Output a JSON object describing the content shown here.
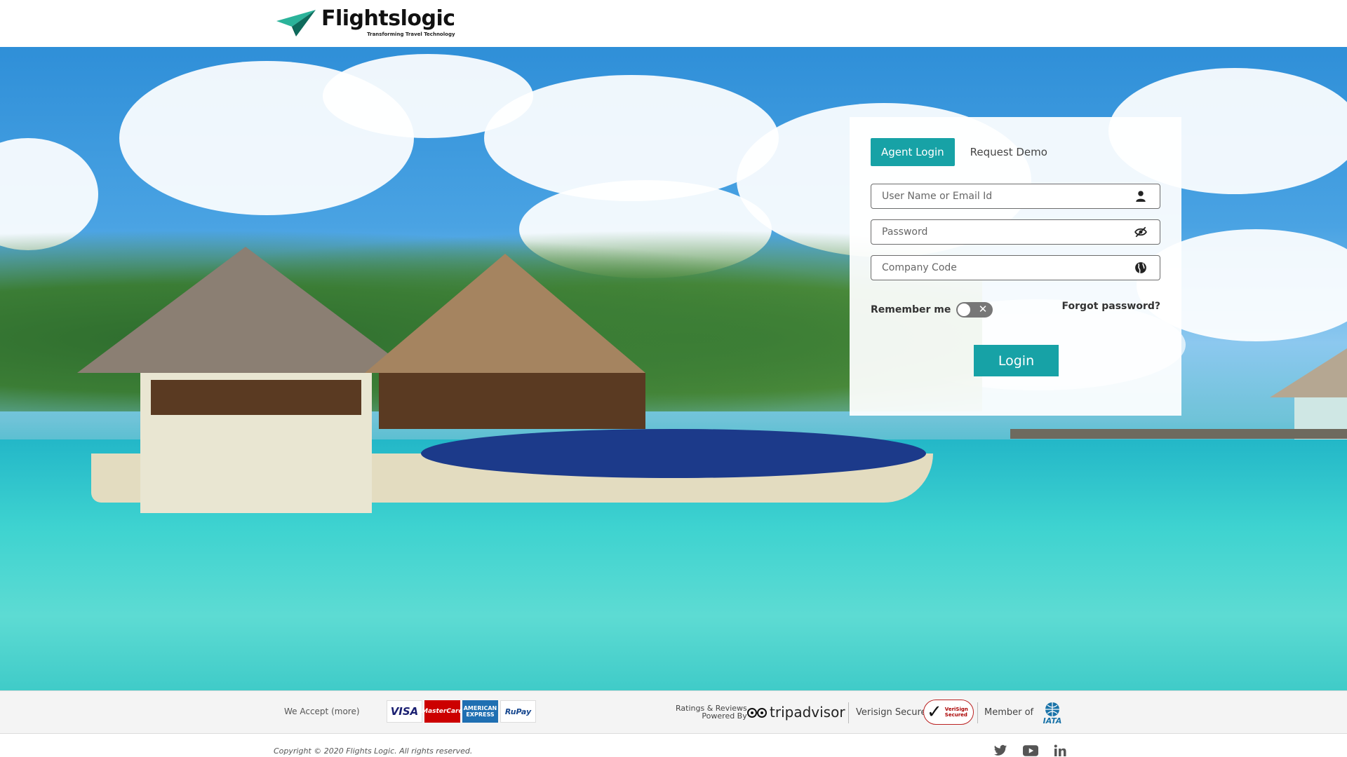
{
  "header": {
    "brand_name": "Flightslogic",
    "brand_tagline": "Transforming Travel Technology",
    "brand_colors": {
      "mark_primary": "#17a589",
      "mark_secondary": "#0e6b5c"
    }
  },
  "login": {
    "tabs": [
      {
        "label": "Agent Login",
        "active": true
      },
      {
        "label": "Request Demo",
        "active": false
      }
    ],
    "username_placeholder": "User Name or Email Id",
    "password_placeholder": "Password",
    "company_placeholder": "Company Code",
    "username_icon": "user-icon",
    "password_icon": "eye-slash-icon",
    "company_icon": "globe-icon",
    "remember_label": "Remember me",
    "remember_on": false,
    "forgot_label": "Forgot password?",
    "login_button": "Login",
    "accent_color": "#17a2a6"
  },
  "footer": {
    "accept_label": "We Accept (more)",
    "cards": [
      "VISA",
      "MasterCard",
      "AMERICAN EXPRESS",
      "RuPay"
    ],
    "ratings_line1": "Ratings & Reviews",
    "ratings_line2": "Powered By",
    "tripadvisor": "tripadvisor",
    "verisign_label": "Verisign Secure",
    "verisign_badge": "VeriSign Secured",
    "member_label": "Member of",
    "iata": "IATA"
  },
  "bottom": {
    "copyright": "Copyright © 2020 Flights Logic. All rights reserved.",
    "social": [
      "twitter-icon",
      "youtube-icon",
      "linkedin-icon"
    ]
  }
}
